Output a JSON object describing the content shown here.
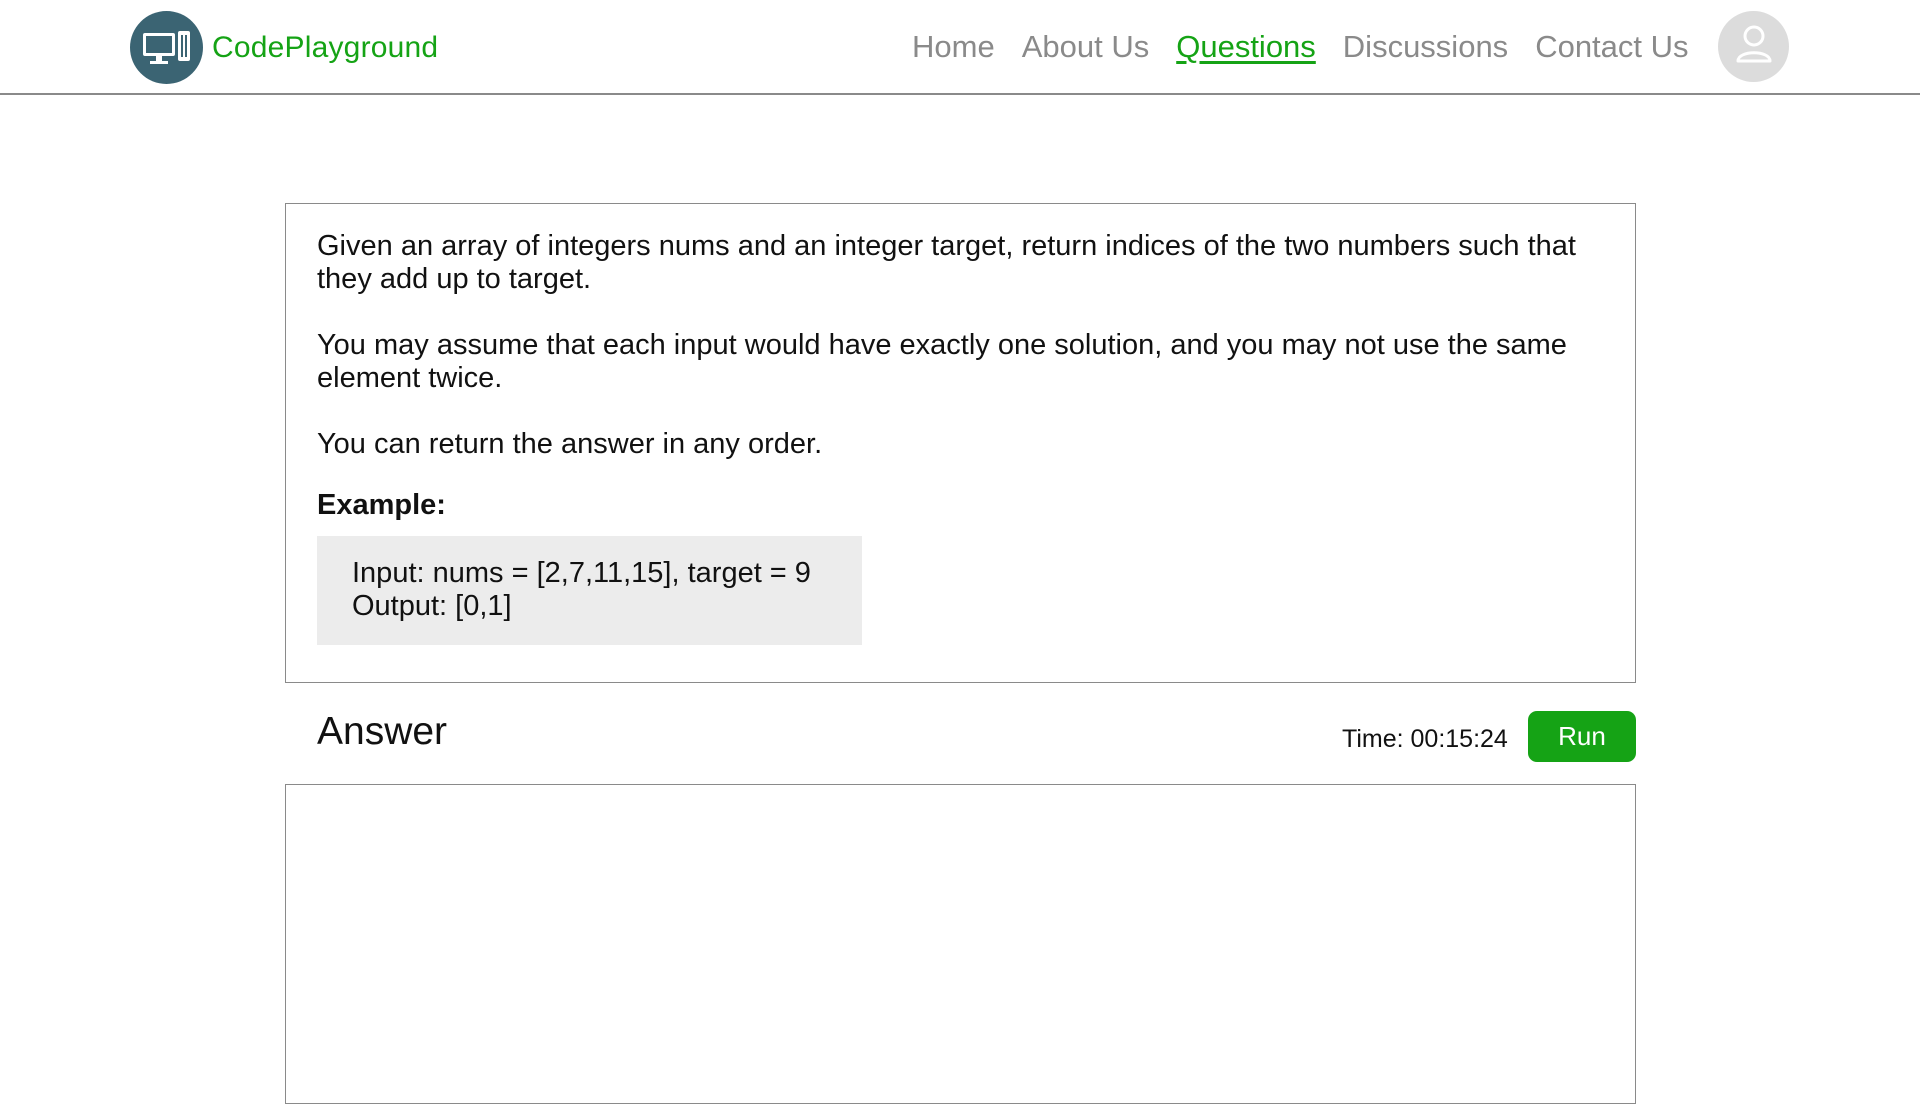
{
  "brand": {
    "name": "CodePlayground",
    "logo_icon": "monitor-icon",
    "color": "#15a315"
  },
  "nav": {
    "items": [
      {
        "label": "Home",
        "active": false
      },
      {
        "label": "About Us",
        "active": false
      },
      {
        "label": "Questions",
        "active": true
      },
      {
        "label": "Discussions",
        "active": false
      },
      {
        "label": "Contact Us",
        "active": false
      }
    ],
    "active_color": "#15a315",
    "inactive_color": "#8a8a8a"
  },
  "user": {
    "avatar_icon": "user-icon"
  },
  "question": {
    "paragraphs": [
      "Given an array of integers nums and an integer target, return indices of the two numbers such that they add up to target.",
      "You may assume that each input would have exactly one solution, and you may not use the same element twice.",
      "You can return the answer in any order."
    ],
    "example_heading": "Example:",
    "example_input": "Input: nums = [2,7,11,15], target = 9",
    "example_output": "Output: [0,1]"
  },
  "answer": {
    "title": "Answer",
    "timer": "Time: 00:15:24",
    "run_label": "Run",
    "editor_value": "",
    "run_color": "#15a315"
  }
}
